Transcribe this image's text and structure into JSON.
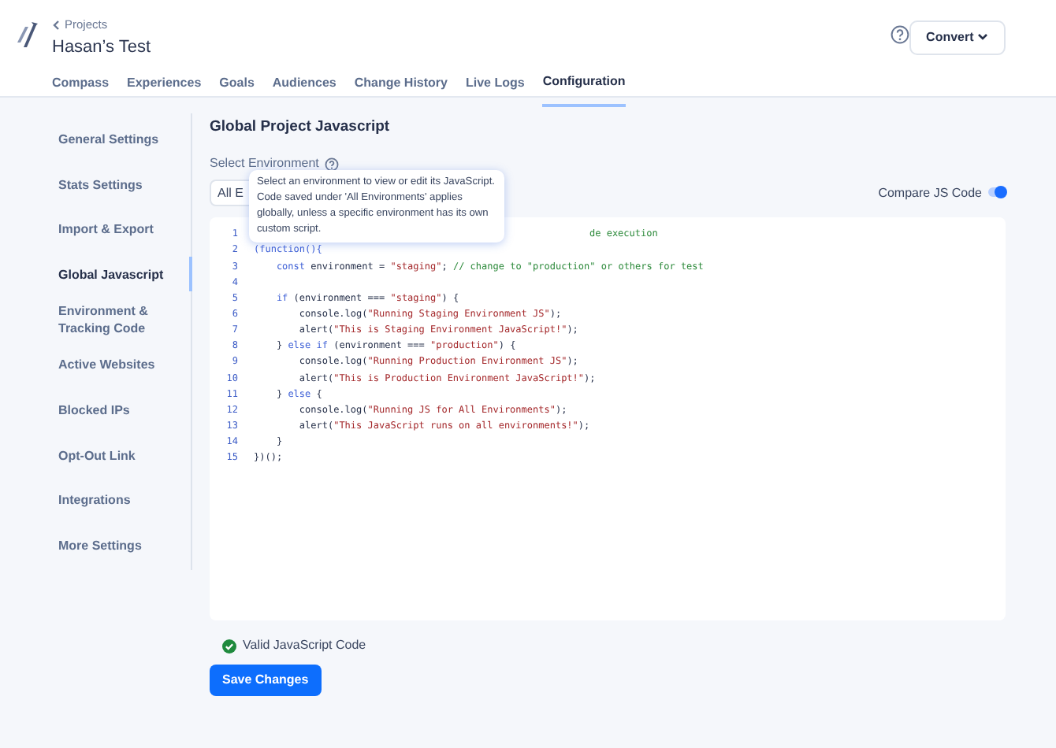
{
  "header": {
    "back_link": "Projects",
    "title": "Hasan’s Test",
    "help_icon": true,
    "convert_button": "Convert"
  },
  "tabs": [
    {
      "label": "Compass",
      "selected": false
    },
    {
      "label": "Experiences",
      "selected": false
    },
    {
      "label": "Goals",
      "selected": false
    },
    {
      "label": "Audiences",
      "selected": false
    },
    {
      "label": "Change History",
      "selected": false
    },
    {
      "label": "Live Logs",
      "selected": false
    },
    {
      "label": "Configuration",
      "selected": true
    }
  ],
  "sidebar": {
    "items": [
      {
        "label": "General Settings",
        "selected": false
      },
      {
        "label": "Stats Settings",
        "selected": false
      },
      {
        "label": "Import & Export",
        "selected": false
      },
      {
        "label": "Global Javascript",
        "selected": true
      },
      {
        "label": "Environment & Tracking Code",
        "selected": false
      },
      {
        "label": "Active Websites",
        "selected": false
      },
      {
        "label": "Blocked IPs",
        "selected": false
      },
      {
        "label": "Opt-Out Link",
        "selected": false
      },
      {
        "label": "Integrations",
        "selected": false
      },
      {
        "label": "More Settings",
        "selected": false
      }
    ]
  },
  "main": {
    "title": "Global Project Javascript",
    "environment_label": "Select Environment",
    "environment_value": "All E",
    "tooltip": "Select an environment to view or edit its JavaScript. Code saved under 'All Environments' applies globally, unless a specific environment has its own custom script.",
    "compare_label": "Compare JS Code",
    "compare_on": true,
    "code_lines": [
      {
        "number": "1",
        "covered": true,
        "segments": [
          {
            "kind": "comment",
            "text": "de execution"
          }
        ]
      },
      {
        "number": "2",
        "covered": false,
        "segments": [
          {
            "kind": "punct",
            "text": "(function(){"
          }
        ]
      },
      {
        "number": "3",
        "covered": false,
        "segments": [
          {
            "kind": "keyword",
            "text": "    const"
          },
          {
            "kind": "plain",
            "text": " environment = "
          },
          {
            "kind": "string",
            "text": "\"staging\""
          },
          {
            "kind": "plain",
            "text": "; "
          },
          {
            "kind": "comment",
            "text": "// change to \"production\" or others for test"
          }
        ]
      },
      {
        "number": "4",
        "covered": false
      },
      {
        "number": "5",
        "covered": false,
        "segments": [
          {
            "kind": "keyword",
            "text": "    if"
          },
          {
            "kind": "plain",
            "text": " (environment === "
          },
          {
            "kind": "string",
            "text": "\"staging\""
          },
          {
            "kind": "plain",
            "text": ") {"
          }
        ]
      },
      {
        "number": "6",
        "covered": false,
        "segments": [
          {
            "kind": "plain",
            "text": "        console.log("
          },
          {
            "kind": "string",
            "text": "\"Running Staging Environment JS\""
          },
          {
            "kind": "plain",
            "text": ");"
          }
        ]
      },
      {
        "number": "7",
        "covered": false,
        "segments": [
          {
            "kind": "plain",
            "text": "        alert("
          },
          {
            "kind": "string",
            "text": "\"This is Staging Environment JavaScript!\""
          },
          {
            "kind": "plain",
            "text": ");"
          }
        ]
      },
      {
        "number": "8",
        "covered": false,
        "segments": [
          {
            "kind": "plain",
            "text": "    } "
          },
          {
            "kind": "keyword",
            "text": "else if"
          },
          {
            "kind": "plain",
            "text": " (environment === "
          },
          {
            "kind": "string",
            "text": "\"production\""
          },
          {
            "kind": "plain",
            "text": ") {"
          }
        ]
      },
      {
        "number": "9",
        "covered": false,
        "segments": [
          {
            "kind": "plain",
            "text": "        console.log("
          },
          {
            "kind": "string",
            "text": "\"Running Production Environment JS\""
          },
          {
            "kind": "plain",
            "text": ");"
          }
        ]
      },
      {
        "number": "10",
        "covered": false,
        "segments": [
          {
            "kind": "plain",
            "text": "        alert("
          },
          {
            "kind": "string",
            "text": "\"This is Production Environment JavaScript!\""
          },
          {
            "kind": "plain",
            "text": ");"
          }
        ]
      },
      {
        "number": "11",
        "covered": false,
        "segments": [
          {
            "kind": "plain",
            "text": "    } "
          },
          {
            "kind": "keyword",
            "text": "else"
          },
          {
            "kind": "plain",
            "text": " {"
          }
        ]
      },
      {
        "number": "12",
        "covered": false,
        "segments": [
          {
            "kind": "plain",
            "text": "        console.log("
          },
          {
            "kind": "string",
            "text": "\"Running JS for All Environments\""
          },
          {
            "kind": "plain",
            "text": ");"
          }
        ]
      },
      {
        "number": "13",
        "covered": false,
        "segments": [
          {
            "kind": "plain",
            "text": "        alert("
          },
          {
            "kind": "string",
            "text": "\"This JavaScript runs on all environments!\""
          },
          {
            "kind": "plain",
            "text": ");"
          }
        ]
      },
      {
        "number": "14",
        "covered": false,
        "segments": [
          {
            "kind": "plain",
            "text": "    }"
          }
        ]
      },
      {
        "number": "15",
        "covered": false,
        "segments": [
          {
            "kind": "plain",
            "text": "})();"
          }
        ]
      }
    ],
    "validation": "Valid JavaScript Code",
    "valid": true,
    "save_button": "Save Changes"
  }
}
